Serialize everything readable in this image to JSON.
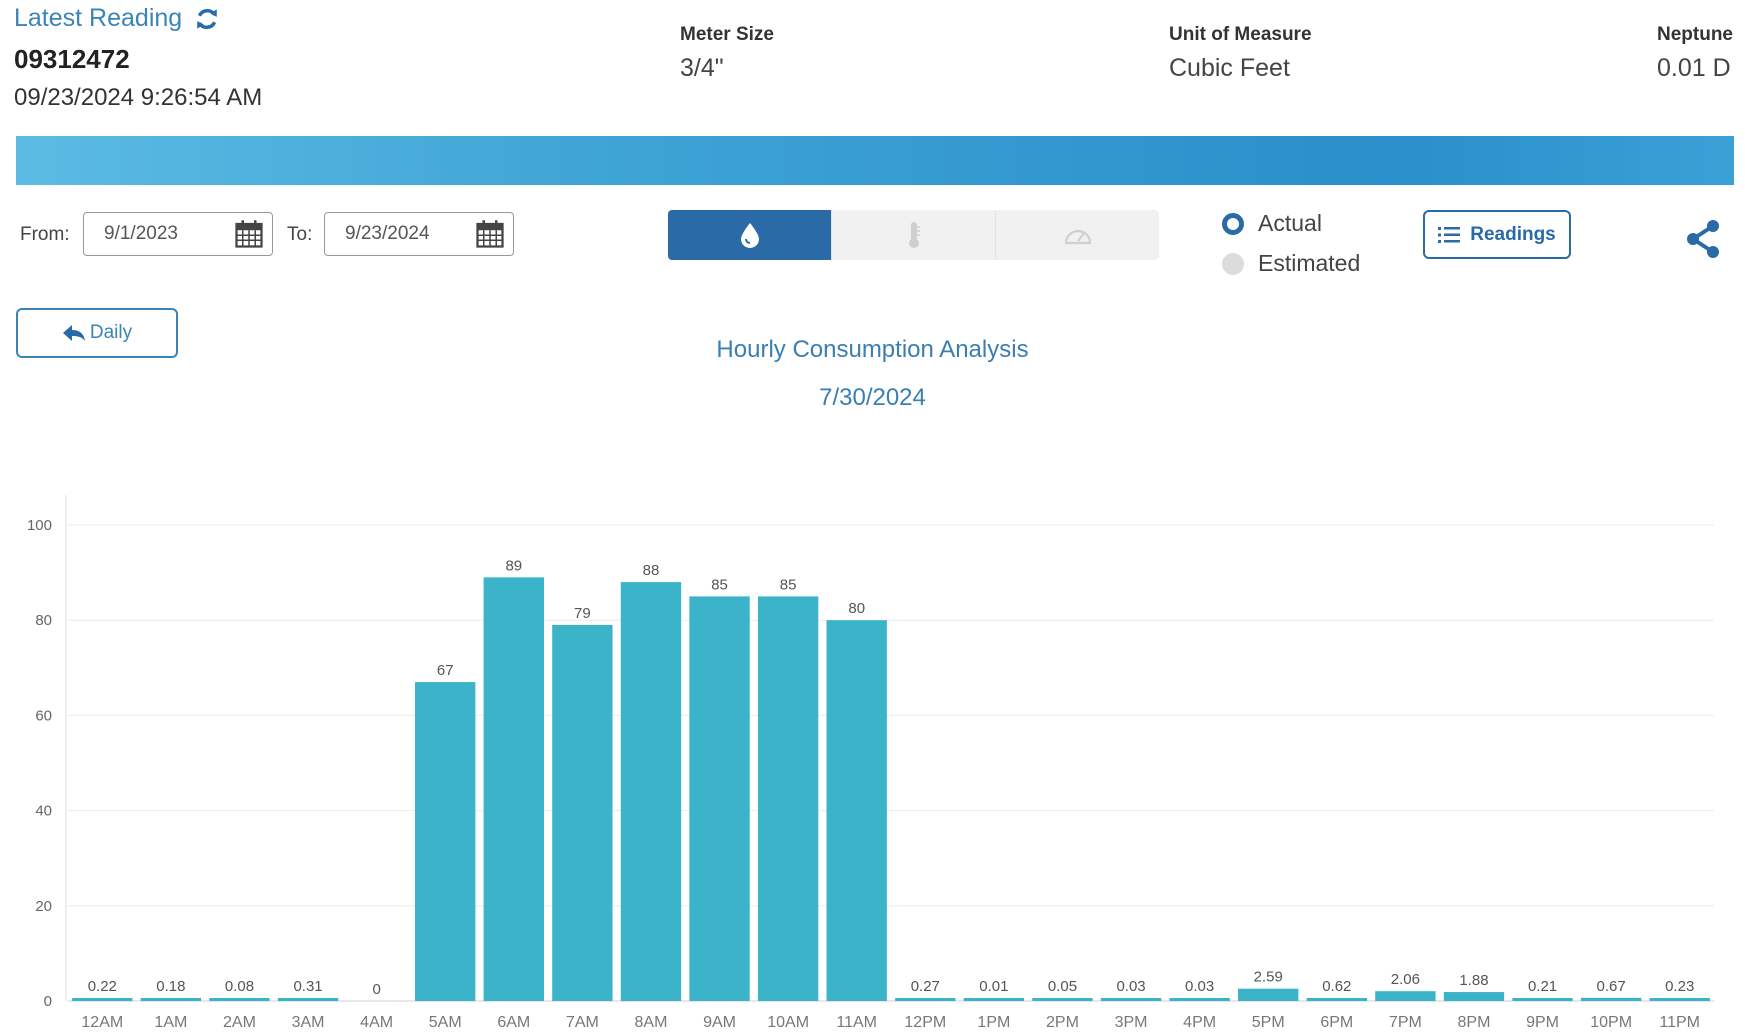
{
  "header": {
    "latest_reading_label": "Latest Reading",
    "meter_number": "09312472",
    "reading_datetime": "09/23/2024 9:26:54 AM",
    "meter_size_label": "Meter Size",
    "meter_size_value": "3/4\"",
    "unit_label": "Unit of Measure",
    "unit_value": "Cubic Feet",
    "neptune_label": "Neptune",
    "neptune_value": "0.01 D"
  },
  "controls": {
    "from_label": "From:",
    "from_value": "9/1/2023",
    "to_label": "To:",
    "to_value": "9/23/2024",
    "radio_actual": "Actual",
    "radio_estimated": "Estimated",
    "radio_selected": "Actual",
    "readings_label": "Readings",
    "daily_label": "Daily",
    "segments": [
      {
        "icon": "water-drop-icon",
        "active": true
      },
      {
        "icon": "thermometer-icon",
        "active": false
      },
      {
        "icon": "gauge-icon",
        "active": false
      }
    ]
  },
  "colors": {
    "accent": "#2a6aa6",
    "title": "#3a7fb0",
    "bar": "#3bb3c9"
  },
  "chart_data": {
    "type": "bar",
    "title": "Hourly Consumption Analysis",
    "subtitle": "7/30/2024",
    "categories": [
      "12AM",
      "1AM",
      "2AM",
      "3AM",
      "4AM",
      "5AM",
      "6AM",
      "7AM",
      "8AM",
      "9AM",
      "10AM",
      "11AM",
      "12PM",
      "1PM",
      "2PM",
      "3PM",
      "4PM",
      "5PM",
      "6PM",
      "7PM",
      "8PM",
      "9PM",
      "10PM",
      "11PM"
    ],
    "values": [
      0.22,
      0.18,
      0.08,
      0.31,
      0,
      67,
      89,
      79,
      88,
      85,
      85,
      80,
      0.27,
      0.01,
      0.05,
      0.03,
      0.03,
      2.59,
      0.62,
      2.06,
      1.88,
      0.21,
      0.67,
      0.23
    ],
    "labels": [
      "0.22",
      "0.18",
      "0.08",
      "0.31",
      "0",
      "67",
      "89",
      "79",
      "88",
      "85",
      "85",
      "80",
      "0.27",
      "0.01",
      "0.05",
      "0.03",
      "0.03",
      "2.59",
      "0.62",
      "2.06",
      "1.88",
      "0.21",
      "0.67",
      "0.23"
    ],
    "yticks": [
      0,
      20,
      40,
      60,
      80,
      100
    ],
    "ylim": [
      0,
      100
    ],
    "grid": true
  }
}
